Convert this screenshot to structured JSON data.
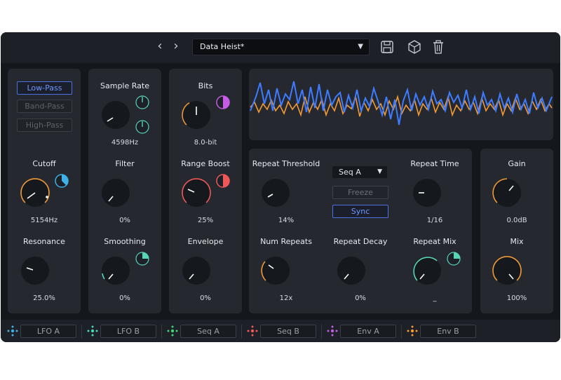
{
  "preset": {
    "name": "Data Heist*"
  },
  "filter": {
    "types": [
      "Low-Pass",
      "Band-Pass",
      "High-Pass"
    ],
    "selected": "Low-Pass"
  },
  "knobs": {
    "cutoff": {
      "label": "Cutoff",
      "value": "5154Hz"
    },
    "resonance": {
      "label": "Resonance",
      "value": "25.0%"
    },
    "sample_rate": {
      "label": "Sample Rate",
      "value": "4598Hz"
    },
    "filter": {
      "label": "Filter",
      "value": "0%"
    },
    "smoothing": {
      "label": "Smoothing",
      "value": "0%"
    },
    "bits": {
      "label": "Bits",
      "value": "8.0-bit"
    },
    "range_boost": {
      "label": "Range Boost",
      "value": "25%"
    },
    "envelope": {
      "label": "Envelope",
      "value": "0%"
    },
    "repeat_threshold": {
      "label": "Repeat Threshold",
      "value": "14%"
    },
    "num_repeats": {
      "label": "Num Repeats",
      "value": "12x"
    },
    "repeat_decay": {
      "label": "Repeat Decay",
      "value": "0%"
    },
    "repeat_time": {
      "label": "Repeat Time",
      "value": "1/16"
    },
    "repeat_mix": {
      "label": "Repeat Mix",
      "value": "_"
    },
    "gain": {
      "label": "Gain",
      "value": "0.0dB"
    },
    "mix": {
      "label": "Mix",
      "value": "100%"
    }
  },
  "repeat": {
    "source": "Seq A",
    "freeze_label": "Freeze",
    "sync_label": "Sync",
    "sync_on": true,
    "freeze_on": false
  },
  "modulators": [
    {
      "name": "LFO A",
      "color": "#3fb0e8"
    },
    {
      "name": "LFO B",
      "color": "#49d6b8"
    },
    {
      "name": "Seq A",
      "color": "#43d27a"
    },
    {
      "name": "Seq B",
      "color": "#f05858"
    },
    {
      "name": "Env A",
      "color": "#c65be6"
    },
    {
      "name": "Env B",
      "color": "#f29a35"
    }
  ],
  "colors": {
    "accent_orange": "#f29a35",
    "accent_blue": "#3d7bff",
    "accent_red": "#f05858",
    "accent_teal": "#56d6b5",
    "accent_cyan": "#3fb0e8",
    "accent_magenta": "#c65be6"
  },
  "icons": {
    "prev": "chevron-left-icon",
    "next": "chevron-right-icon",
    "save": "save-icon",
    "randomize": "dice-icon",
    "delete": "trash-icon"
  }
}
